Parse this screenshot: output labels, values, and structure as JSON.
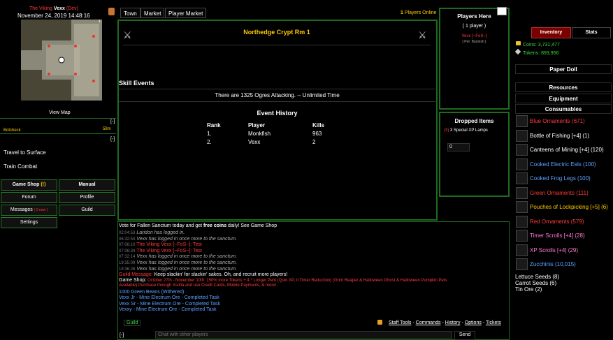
{
  "user": {
    "name_prefix": "The Viking",
    "name": "Vexx",
    "name_suffix": "(Dev)",
    "date": "November 24, 2019 14:48:16"
  },
  "map": {
    "label": "View Map",
    "corner": "1"
  },
  "nav": {
    "town": "Town",
    "market": "Market",
    "player_market": "Player Market",
    "online_count": "1",
    "online_label": "Players Online"
  },
  "left": {
    "collapse1": "[-]",
    "botcheck": "Botcheck",
    "botcheck_time": "58m",
    "collapse2": "[-]",
    "actions": [
      "Travel to Surface",
      "Train Combat"
    ],
    "buttons": {
      "game_shop": "Game Shop",
      "game_shop_badge": "(!)",
      "manual": "Manual",
      "forum": "Forum",
      "profile": "Profile",
      "messages": "Messages",
      "messages_badge": "( 0 new )",
      "guild": "Guild",
      "settings": "Settings"
    }
  },
  "main": {
    "room_title": "Northedge Crypt Rm 1",
    "skill_events": "Skill Events",
    "event_text": "There are 1325 Ogres Attacking. -- Unlimited Time",
    "history_title": "Event History",
    "headers": {
      "rank": "Rank",
      "player": "Player",
      "kills": "Kills"
    },
    "rows": [
      {
        "rank": "1.",
        "player": "Monkfish",
        "kills": "963"
      },
      {
        "rank": "2.",
        "player": "Vexx",
        "kills": "2"
      }
    ]
  },
  "players_here": {
    "title": "Players Here",
    "count": "( 1 player )",
    "player": "Vexx [~FoS~]",
    "tag": "[ Pet: Bunnish ]"
  },
  "dropped": {
    "title": "Dropped Items",
    "count": "(3)",
    "item": "3 Special XP Lamps",
    "input_value": "0"
  },
  "inventory": {
    "tab_inventory": "Inventory",
    "tab_stats": "Stats",
    "coins": "Coins: 3,731,477",
    "tokens": "Tokens: 893,956",
    "paper_doll": "Paper Doll",
    "resources": "Resources",
    "equipment": "Equipment",
    "consumables": "Consumables",
    "items": [
      {
        "name": "Blue Ornaments (671)",
        "color": "#ff3b3b"
      },
      {
        "name": "Bottle of Fishing [+4] (1)",
        "color": "#ffffff"
      },
      {
        "name": "Canteens of Mining [+4] (120)",
        "color": "#ffffff"
      },
      {
        "name": "Cooked Electric Eels (100)",
        "color": "#5da0ff"
      },
      {
        "name": "Cooked Frog Legs (100)",
        "color": "#5da0ff"
      },
      {
        "name": "Green Ornaments (111)",
        "color": "#ff3b3b"
      },
      {
        "name": "Pouches of Lockpicking [+5] (6)",
        "color": "#ffcc00"
      },
      {
        "name": "Red Ornaments (579)",
        "color": "#ff3b3b"
      },
      {
        "name": "Timer Scrolls [+4] (28)",
        "color": "#ff7bd0"
      },
      {
        "name": "XP Scrolls [+4] (29)",
        "color": "#ff7bd0"
      },
      {
        "name": "Zucchinis (10,015)",
        "color": "#5da0ff"
      }
    ],
    "seeds": [
      "Lettuce Seeds (8)",
      "Carrot Seeds (6)",
      "Tin Ore (2)"
    ]
  },
  "chat": {
    "announce_prefix": "Vote for Fallen Sanctum today and get ",
    "announce_bold": "free coins",
    "announce_suffix": " daily! See Game Shop",
    "lines": [
      {
        "ts": "02:04:53",
        "text": "Laridon has logged in.",
        "color": "#aaaaaa",
        "italic": true
      },
      {
        "ts": "06:32:53",
        "text": "Vexx has logged in once more to the sanctum.",
        "color": "#aaaaaa",
        "italic": true
      },
      {
        "ts": "07:06:10",
        "text": "The Viking Vexx [~FoS~]: Test",
        "color": "#ff3b3b",
        "italic": false
      },
      {
        "ts": "07:06:34",
        "text": "The Viking Vexx [~FoS~]: Test",
        "color": "#ff3b3b",
        "italic": false
      },
      {
        "ts": "07:32:14",
        "text": "Vexx has logged in once more to the sanctum.",
        "color": "#aaaaaa",
        "italic": true
      },
      {
        "ts": "19:35:09",
        "text": "Vexx has logged in once more to the sanctum.",
        "color": "#aaaaaa",
        "italic": true
      },
      {
        "ts": "19:36:26",
        "text": "Vexx has logged in once more to the sanctum.",
        "color": "#aaaaaa",
        "italic": true
      }
    ],
    "guild_msg_label": "Guild Message:",
    "guild_msg": " Keep slackin' for slackin' sakes. Oh, and recruit more players!",
    "shop_label": "Game Shop:",
    "shop_line1": " October 27th - November 10th: 150% more Tokens + 4 * Longer Perk (Quin XP, II Timer Reduction) (Grim Reaper & Halloween Ghost & Halloween Pumpkin Pets",
    "shop_line2": "Available) Purchase through Xsolla and use Credit Cards, Mobile Payments, & more!",
    "green_beans": "1000 Green Beans (Withered)",
    "tasks": [
      "Vexx Jr - Mine Electrum Ore - Completed Task",
      "Vexx Sr - Mine Electrum Ore - Completed Task",
      "Vexxy - Mine Electrum Ore - Completed Task"
    ],
    "tab_guild": "Guild",
    "links": [
      "Staff Tools",
      "Commands",
      "History",
      "Options",
      "Tickets"
    ],
    "collapse": "[-]",
    "placeholder": "Chat with other players",
    "send": "Send"
  }
}
